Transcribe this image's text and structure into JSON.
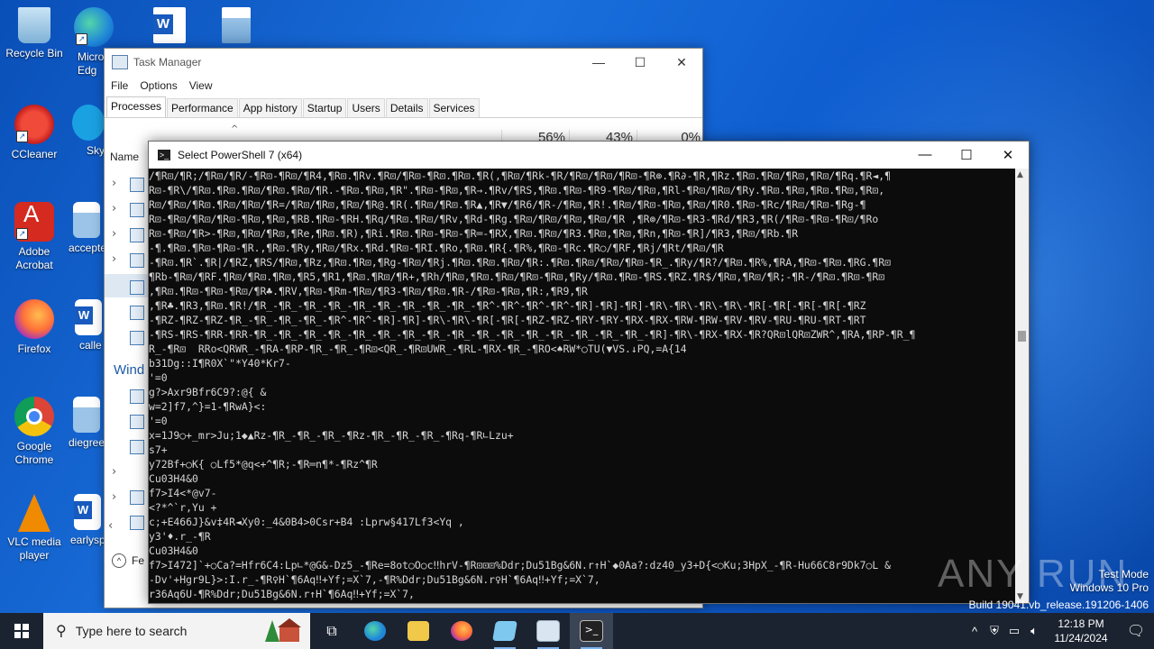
{
  "desktop": {
    "icons": [
      {
        "label": "Recycle Bin"
      },
      {
        "label": "Micro\nEdg"
      },
      {
        "label": "CCleaner"
      },
      {
        "label": "Sky"
      },
      {
        "label": "Adobe\nAcrobat"
      },
      {
        "label": "accepte"
      },
      {
        "label": "Firefox"
      },
      {
        "label": "calle"
      },
      {
        "label": "Google\nChrome"
      },
      {
        "label": "diegree"
      },
      {
        "label": "VLC media\nplayer"
      },
      {
        "label": "earlysp"
      }
    ]
  },
  "task_manager": {
    "title": "Task Manager",
    "menu": [
      "File",
      "Options",
      "View"
    ],
    "tabs": [
      "Processes",
      "Performance",
      "App history",
      "Startup",
      "Users",
      "Details",
      "Services"
    ],
    "active_tab": "Processes",
    "stats": [
      "56%",
      "43%",
      "0%"
    ],
    "name_header": "Name",
    "section": "Wind",
    "fewer_details": "Fe"
  },
  "powershell": {
    "title": "Select PowerShell 7 (x64)",
    "lines": [
      "/¶R⊡/¶R;/¶R⊡/¶R/-¶R⊡-¶R⊡/¶R4,¶R⊡.¶Rv.¶R⊡/¶R⊡-¶R⊡.¶R⊡.¶R(,¶R⊡/¶Rk-¶R/¶R⊡/¶R⊡/¶R⊡-¶R⊚.¶R∂-¶R,¶Rz.¶R⊡.¶R⊡/¶R⊡,¶R⊡/¶Rq.¶R◄,¶",
      "R⊡-¶R\\/¶R⊡.¶R⊡.¶R⊡/¶R⊡.¶R⊡/¶R.-¶R⊡.¶R⊡,¶R\".¶R⊡-¶R⊡,¶R→.¶Rv/¶RS,¶R⊡.¶R⊡-¶R9-¶R⊡/¶R⊡,¶Rl-¶R⊡/¶R⊡/¶Ry.¶R⊡.¶R⊡,¶R⊡.¶R⊡,¶R⊡,",
      "R⊡/¶R⊡/¶R⊡.¶R⊡/¶R⊡/¶R=/¶R⊡/¶R⊡,¶R⊡/¶R@.¶R(.¶R⊡/¶R⊡.¶R▲,¶R▼/¶R6/¶R-/¶R⊡,¶R!.¶R⊡/¶R⊡-¶R⊡,¶R⊡/¶R0.¶R⊡-¶Rc/¶R⊡/¶R⊡-¶Rg-¶",
      "R⊡-¶R⊡/¶R⊡/¶R⊡-¶R⊡,¶R⊡,¶RB.¶R⊡-¶RH.¶Rq/¶R⊡.¶R⊡/¶Rv,¶Rd-¶Rg.¶R⊡/¶R⊡/¶R⊡,¶R⊡/¶R ,¶R⊚/¶R⊡-¶R3-¶Rd/¶R3,¶R(/¶R⊡-¶R⊡-¶R⊡/¶Ro",
      "R⊡-¶R⊡/¶R>-¶R⊡,¶R⊡/¶R⊡,¶Re,¶R⊡.¶R),¶Ri.¶R⊡.¶R⊡-¶R⊡-¶R═-¶RX,¶R⊡.¶R⊡/¶R3.¶R⊡,¶R⊡,¶Rn,¶R⊡-¶R]/¶R3,¶R⊡/¶Rb.¶R",
      "-¶.¶R⊡.¶R⊡-¶R⊡-¶R.,¶R⊡.¶Ry,¶R⊡/¶Rx.¶Rd.¶R⊡-¶RI.¶Ro,¶R⊡.¶R{.¶R%,¶R⊡-¶Rc.¶R○/¶RF,¶Rj/¶Rt/¶R⊡/¶R",
      "-¶R⊡.¶R`.¶R|/¶RZ,¶RS/¶R⊡,¶Rz,¶R⊡.¶R⊡,¶Rg-¶R⊡/¶Rj.¶R⊡.¶R⊡.¶R⊡/¶R:.¶R⊡.¶R⊡/¶R⊡/¶R⊡-¶R_.¶Ry/¶R?/¶R⊡.¶R%,¶RA,¶R⊡-¶R⊡.¶RG.¶R⊡",
      "¶Rb-¶R⊡/¶RF.¶R⊡/¶R⊡.¶R⊡,¶R5,¶R1,¶R⊡.¶R⊡/¶R+,¶Rh/¶R⊡,¶R⊡.¶R⊡/¶R⊡-¶R⊡,¶Ry/¶R⊡.¶R⊡-¶RS.¶RZ.¶R$/¶R⊡,¶R⊡/¶R;-¶R-/¶R⊡.¶R⊡-¶R⊡",
      ",¶R⊡.¶R⊡-¶R⊡-¶R⊡/¶R♣.¶RV,¶R⊡-¶Rm-¶R⊡/¶R3-¶R⊡/¶R⊡.¶R-/¶R⊡-¶R⊡,¶R:,¶R9,¶R",
      ",¶R♣.¶R3,¶R⊡.¶R!/¶R_-¶R_-¶R_-¶R_-¶R_-¶R_-¶R_-¶R_-¶R_-¶R^-¶R^-¶R^-¶R^-¶R]-¶R]-¶R]-¶R\\-¶R\\-¶R\\-¶R\\-¶R[-¶R[-¶R[-¶R[-¶RZ",
      "-¶RZ-¶RZ-¶RZ-¶R_-¶R_-¶R_-¶R_-¶R^-¶R^-¶R]-¶R]-¶R\\-¶R\\-¶R[-¶R[-¶RZ-¶RZ-¶RY-¶RY-¶RX-¶RX-¶RW-¶RW-¶RV-¶RV-¶RU-¶RU-¶RT-¶RT",
      "-¶RS-¶RS-¶RR-¶RR-¶R_-¶R_-¶R_-¶R_-¶R_-¶R_-¶R_-¶R_-¶R_-¶R_-¶R_-¶R_-¶R_-¶R_-¶R_-¶R_-¶R]-¶R\\-¶RX-¶RX-¶R?QR⊡lQR⊡ZWR^,¶RA,¶RP-¶R_¶",
      "R_-¶R⊡  RRo<QRWR_-¶RA-¶RP-¶R_-¶R_-¶R⊡<QR_-¶R⊡UWR_-¶RL-¶RX-¶R_-¶RO<♠RW*○TU(▼VS.↓PQ,=A{14",
      "b31Dg::I¶R0X`\"*Y40*Kr7-",
      "'=0",
      "g?>Axr9Bfr6C9?:@{ &",
      "w=2]f7,^}=1-¶RwA}<:",
      "'=0",
      "x=1J9○+_mr>Ju;1◆▲Rz-¶R_-¶R_-¶R_-¶Rz-¶R_-¶R_-¶R_-¶Rq-¶R∟Lzu+",
      "s7+",
      "y72Bf+○K{ ○Lf5*@q<+^¶R;-¶R═n¶*-¶Rz^¶R",
      "Cu03H4&0",
      "f7>I4<*@v7-",
      "<?*^`r,Yu +",
      "c;+E466J}&v‡4R◄Xy0:_4&0B4>0Csr+B4 :Lprw§417Lf3<Yq ,",
      "y3'♦.r_-¶R",
      "Cu03H4&0",
      "f7>I472]`+○Ca?=Hfr6C4:Lp∟*@G&-Dz5_-¶Re=8ot○O○c‼hrV-¶R⊡⊡⊡%Ddr;Du51Bg&6N.r↑H`◆0Aa?:dz40_y3+D{<○Ku;3HpX_-¶R-Hu66C8r9Dk7○L &",
      "-Dv'+Hgr9L}>:I.r_-¶R♀H`¶6Aq‼+Yf;=X`7,-¶R%Ddr;Du51Bg&6N.r♀H`¶6Aq‼+Yf;=X`7,",
      "r36Aq6U-¶R%Ddr;Du51Bg&6N.r↑H`¶6Aq‼+Yf;=X`7,"
    ]
  },
  "watermark": "ANY RUN",
  "system_info": {
    "mode": "Test Mode",
    "os": "Windows 10 Pro",
    "build": "Build 19041.vb_release.191206-1406"
  },
  "taskbar": {
    "search_placeholder": "Type here to search",
    "time": "12:18 PM",
    "date": "11/24/2024"
  }
}
